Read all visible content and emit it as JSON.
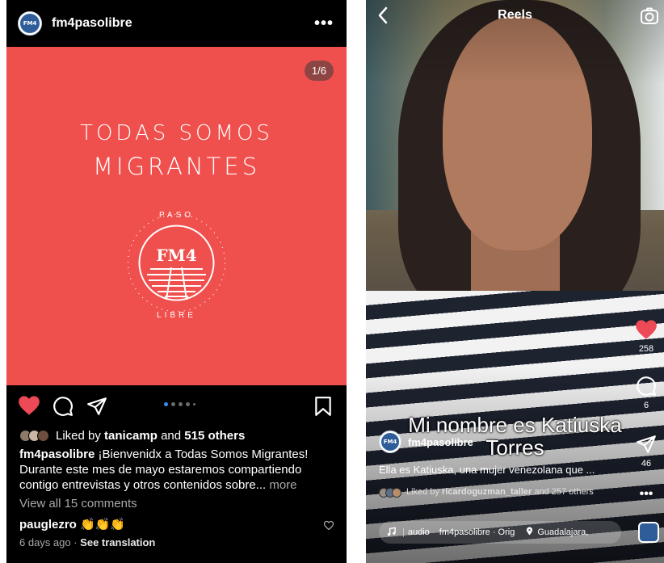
{
  "post": {
    "username": "fm4pasolibre",
    "avatar_text": "FM4",
    "more": "•••",
    "counter": "1/6",
    "headline_line1": "TODAS SOMOS",
    "headline_line2": "MIGRANTES",
    "logo_top": "PASO",
    "logo_center": "FM4",
    "logo_bottom": "LIBRE",
    "liked_by_prefix": "Liked by ",
    "liked_by_user": "tanicamp",
    "liked_by_suffix": " and ",
    "liked_by_others": "515 others",
    "caption_user": "fm4pasolibre",
    "caption_text": " ¡Bienvenidx a Todas Somos Migrantes! Durante este mes de mayo estaremos compartiendo contigo entrevistas y otros contenidos sobre... ",
    "caption_more": "more",
    "view_comments": "View all 15 comments",
    "comment_user": "pauglezro",
    "comment_text": " 👏👏👏",
    "time_ago": "6 days ago",
    "separator": " · ",
    "see_translation": "See translation",
    "colors": {
      "media_bg": "#f0504d",
      "heart": "#ed4956",
      "active_dot": "#3b8ef0"
    }
  },
  "reel": {
    "title": "Reels",
    "subtitle_line1": "Mi nombre es Katiuska",
    "subtitle_line2": "Torres",
    "username": "fm4pasolibre",
    "description": "Ella es Katiuska, una mujer venezolana que ...",
    "likes_prefix": "Liked by ",
    "likes_user": "ricardoguzman_taller",
    "likes_suffix": " and 257 others",
    "like_count": "258",
    "comment_count": "6",
    "share_count": "46",
    "more": "•••",
    "audio_label": "audio",
    "audio_source": "fm4pasolibre · Orig",
    "location": "Guadalajara,"
  },
  "icons": [
    "heart-icon",
    "comment-icon",
    "share-icon",
    "bookmark-icon",
    "back-icon",
    "camera-icon",
    "music-icon",
    "location-pin-icon"
  ]
}
